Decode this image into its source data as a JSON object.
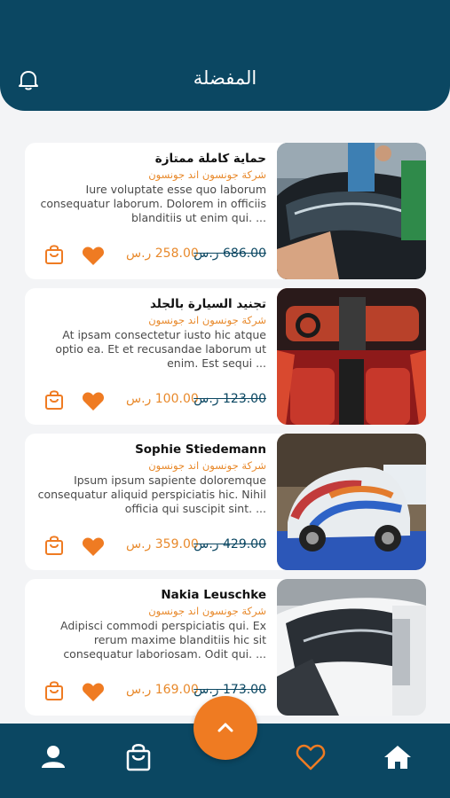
{
  "header": {
    "title": "المفضلة",
    "bell_icon": "bell-icon"
  },
  "products": [
    {
      "title": "حماية كاملة ممتازة",
      "company": "شركة جونسون اند جونسون",
      "description": "Iure voluptate esse quo laborum consequatur laborum. Dolorem in officiis blanditiis ut enim qui. ...",
      "price_new": "258.00 ر.س",
      "price_old": "686.00 ر.س",
      "image": "car-wrap-protection-photo"
    },
    {
      "title": "تجنيد السيارة بالجلد",
      "company": "شركة جونسون اند جونسون",
      "description": "At ipsam consectetur iusto hic atque optio ea. Et et recusandae laborum ut enim. Est sequi ...",
      "price_new": "100.00 ر.س",
      "price_old": "123.00 ر.س",
      "image": "red-leather-interior-photo"
    },
    {
      "title": "Sophie Stiedemann",
      "company": "شركة جونسون اند جونسون",
      "description": "Ipsum ipsum sapiente doloremque consequatur aliquid perspiciatis hic. Nihil officia qui suscipit sint. ...",
      "price_new": "359.00 ر.س",
      "price_old": "429.00 ر.س",
      "image": "art-wrapped-car-photo"
    },
    {
      "title": "Nakia Leuschke",
      "company": "شركة جونسون اند جونسون",
      "description": "Adipisci commodi perspiciatis qui. Ex rerum maxime blanditiis hic sit consequatur laboriosam. Odit qui. ...",
      "price_new": "169.00 ر.س",
      "price_old": "173.00 ر.س",
      "image": "white-car-film-photo"
    }
  ],
  "nav": {
    "items": [
      "profile-icon",
      "shopping-bag-icon",
      "heart-icon",
      "home-icon"
    ],
    "active": "heart-icon"
  },
  "colors": {
    "primary": "#0b4762",
    "accent": "#ef7b22",
    "company_text": "#e8892b"
  }
}
